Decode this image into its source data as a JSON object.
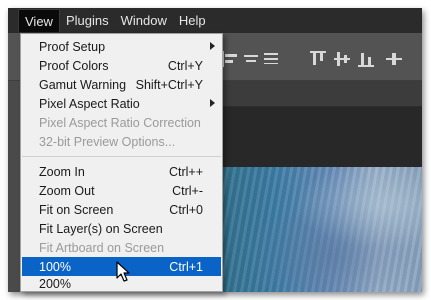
{
  "menubar": {
    "items": [
      {
        "label": "View",
        "active": true
      },
      {
        "label": "Plugins",
        "active": false
      },
      {
        "label": "Window",
        "active": false
      },
      {
        "label": "Help",
        "active": false
      }
    ]
  },
  "view_menu": {
    "items": [
      {
        "label": "Proof Setup",
        "shortcut": "",
        "submenu": true,
        "disabled": false
      },
      {
        "label": "Proof Colors",
        "shortcut": "Ctrl+Y",
        "submenu": false,
        "disabled": false
      },
      {
        "label": "Gamut Warning",
        "shortcut": "Shift+Ctrl+Y",
        "submenu": false,
        "disabled": false
      },
      {
        "label": "Pixel Aspect Ratio",
        "shortcut": "",
        "submenu": true,
        "disabled": false
      },
      {
        "label": "Pixel Aspect Ratio Correction",
        "shortcut": "",
        "submenu": false,
        "disabled": true
      },
      {
        "label": "32-bit Preview Options...",
        "shortcut": "",
        "submenu": false,
        "disabled": true
      },
      {
        "label": "Zoom In",
        "shortcut": "Ctrl++",
        "submenu": false,
        "disabled": false
      },
      {
        "label": "Zoom Out",
        "shortcut": "Ctrl+-",
        "submenu": false,
        "disabled": false
      },
      {
        "label": "Fit on Screen",
        "shortcut": "Ctrl+0",
        "submenu": false,
        "disabled": false
      },
      {
        "label": "Fit Layer(s) on Screen",
        "shortcut": "",
        "submenu": false,
        "disabled": false
      },
      {
        "label": "Fit Artboard on Screen",
        "shortcut": "",
        "submenu": false,
        "disabled": true
      },
      {
        "label": "100%",
        "shortcut": "Ctrl+1",
        "submenu": false,
        "disabled": false,
        "selected": true
      },
      {
        "label": "200%",
        "shortcut": "",
        "submenu": false,
        "disabled": false
      }
    ]
  },
  "colors": {
    "menubar_bg": "#2b2b2b",
    "menu_bg": "#f0f0f0",
    "selection": "#0a64c8",
    "disabled_text": "#9a9a9a"
  },
  "icons": [
    "align-left-icon",
    "align-center-icon",
    "align-right-icon",
    "align-top-icon",
    "align-middle-icon",
    "align-bottom-icon",
    "submenu-arrow-icon",
    "mouse-pointer-icon"
  ]
}
